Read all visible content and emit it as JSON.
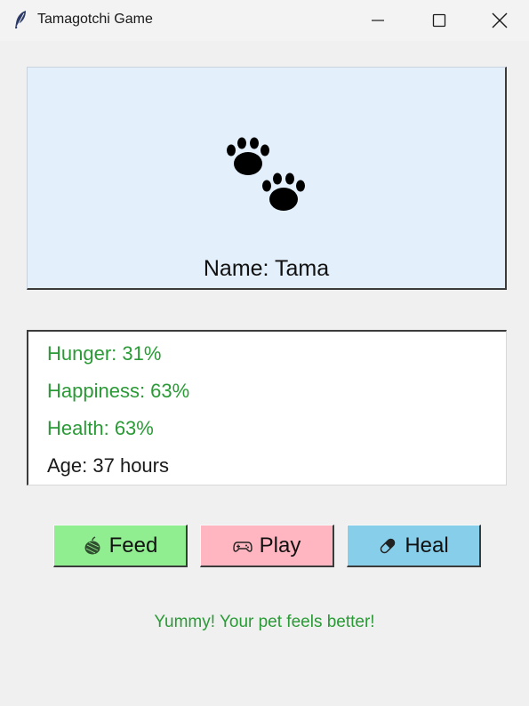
{
  "window": {
    "title": "Tamagotchi Game",
    "icon": "feather-icon"
  },
  "pet": {
    "icon": "paw-prints-icon",
    "name_label": "Name: Tama",
    "panel_color": "#e3effb"
  },
  "stats": {
    "hunger": "Hunger: 31%",
    "happiness": "Happiness: 63%",
    "health": "Health: 63%",
    "age": "Age: 37 hours",
    "ok_color": "#2a9a36"
  },
  "actions": {
    "feed": {
      "label": "Feed",
      "icon": "food-icon",
      "color": "#90ee90"
    },
    "play": {
      "label": "Play",
      "icon": "gamepad-icon",
      "color": "#ffb6c1"
    },
    "heal": {
      "label": "Heal",
      "icon": "pill-icon",
      "color": "#87ceeb"
    }
  },
  "status_message": "Yummy! Your pet feels better!"
}
